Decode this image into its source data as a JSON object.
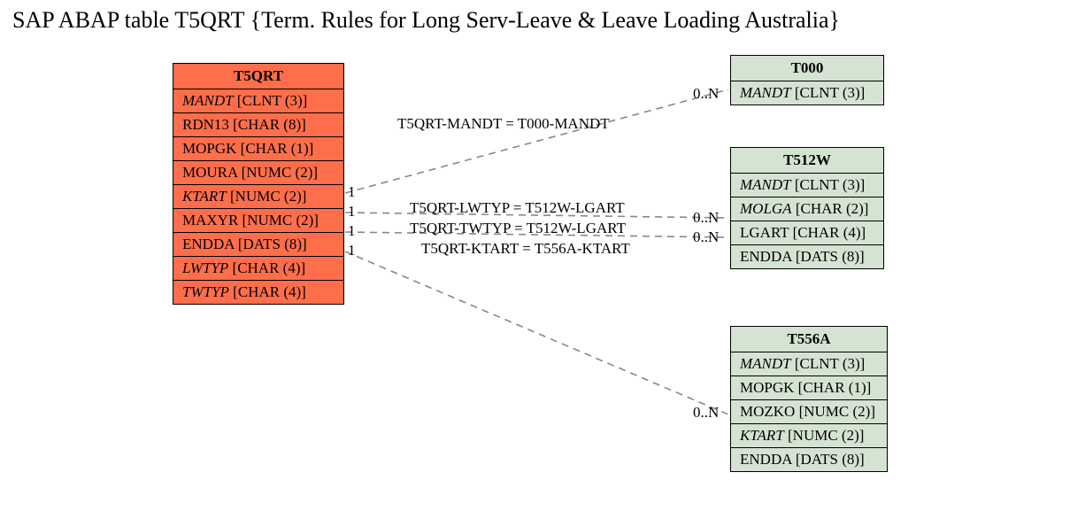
{
  "title": "SAP ABAP table T5QRT {Term. Rules for Long Serv-Leave & Leave Loading Australia}",
  "main": {
    "name": "T5QRT",
    "fields": [
      {
        "key": "MANDT",
        "type": "[CLNT (3)]",
        "italic": true
      },
      {
        "key": "RDN13",
        "type": "[CHAR (8)]",
        "italic": false
      },
      {
        "key": "MOPGK",
        "type": "[CHAR (1)]",
        "italic": false
      },
      {
        "key": "MOURA",
        "type": "[NUMC (2)]",
        "italic": false
      },
      {
        "key": "KTART",
        "type": "[NUMC (2)]",
        "italic": true
      },
      {
        "key": "MAXYR",
        "type": "[NUMC (2)]",
        "italic": false
      },
      {
        "key": "ENDDA",
        "type": "[DATS (8)]",
        "italic": false
      },
      {
        "key": "LWTYP",
        "type": "[CHAR (4)]",
        "italic": true
      },
      {
        "key": "TWTYP",
        "type": "[CHAR (4)]",
        "italic": true
      }
    ]
  },
  "t000": {
    "name": "T000",
    "fields": [
      {
        "key": "MANDT",
        "type": "[CLNT (3)]",
        "italic": true
      }
    ]
  },
  "t512w": {
    "name": "T512W",
    "fields": [
      {
        "key": "MANDT",
        "type": "[CLNT (3)]",
        "italic": true
      },
      {
        "key": "MOLGA",
        "type": "[CHAR (2)]",
        "italic": true
      },
      {
        "key": "LGART",
        "type": "[CHAR (4)]",
        "italic": false
      },
      {
        "key": "ENDDA",
        "type": "[DATS (8)]",
        "italic": false
      }
    ]
  },
  "t556a": {
    "name": "T556A",
    "fields": [
      {
        "key": "MANDT",
        "type": "[CLNT (3)]",
        "italic": true
      },
      {
        "key": "MOPGK",
        "type": "[CHAR (1)]",
        "italic": false
      },
      {
        "key": "MOZKO",
        "type": "[NUMC (2)]",
        "italic": false
      },
      {
        "key": "KTART",
        "type": "[NUMC (2)]",
        "italic": true
      },
      {
        "key": "ENDDA",
        "type": "[DATS (8)]",
        "italic": false
      }
    ]
  },
  "rel": {
    "r1": {
      "text": "T5QRT-MANDT = T000-MANDT",
      "left_card": "1",
      "right_card": "0..N"
    },
    "r2": {
      "text": "T5QRT-LWTYP = T512W-LGART",
      "left_card": "1",
      "right_card": "0..N"
    },
    "r3": {
      "text": "T5QRT-TWTYP = T512W-LGART",
      "left_card": "1",
      "right_card": "0..N"
    },
    "r4": {
      "text": "T5QRT-KTART = T556A-KTART",
      "left_card": "1",
      "right_card": "0..N"
    }
  }
}
